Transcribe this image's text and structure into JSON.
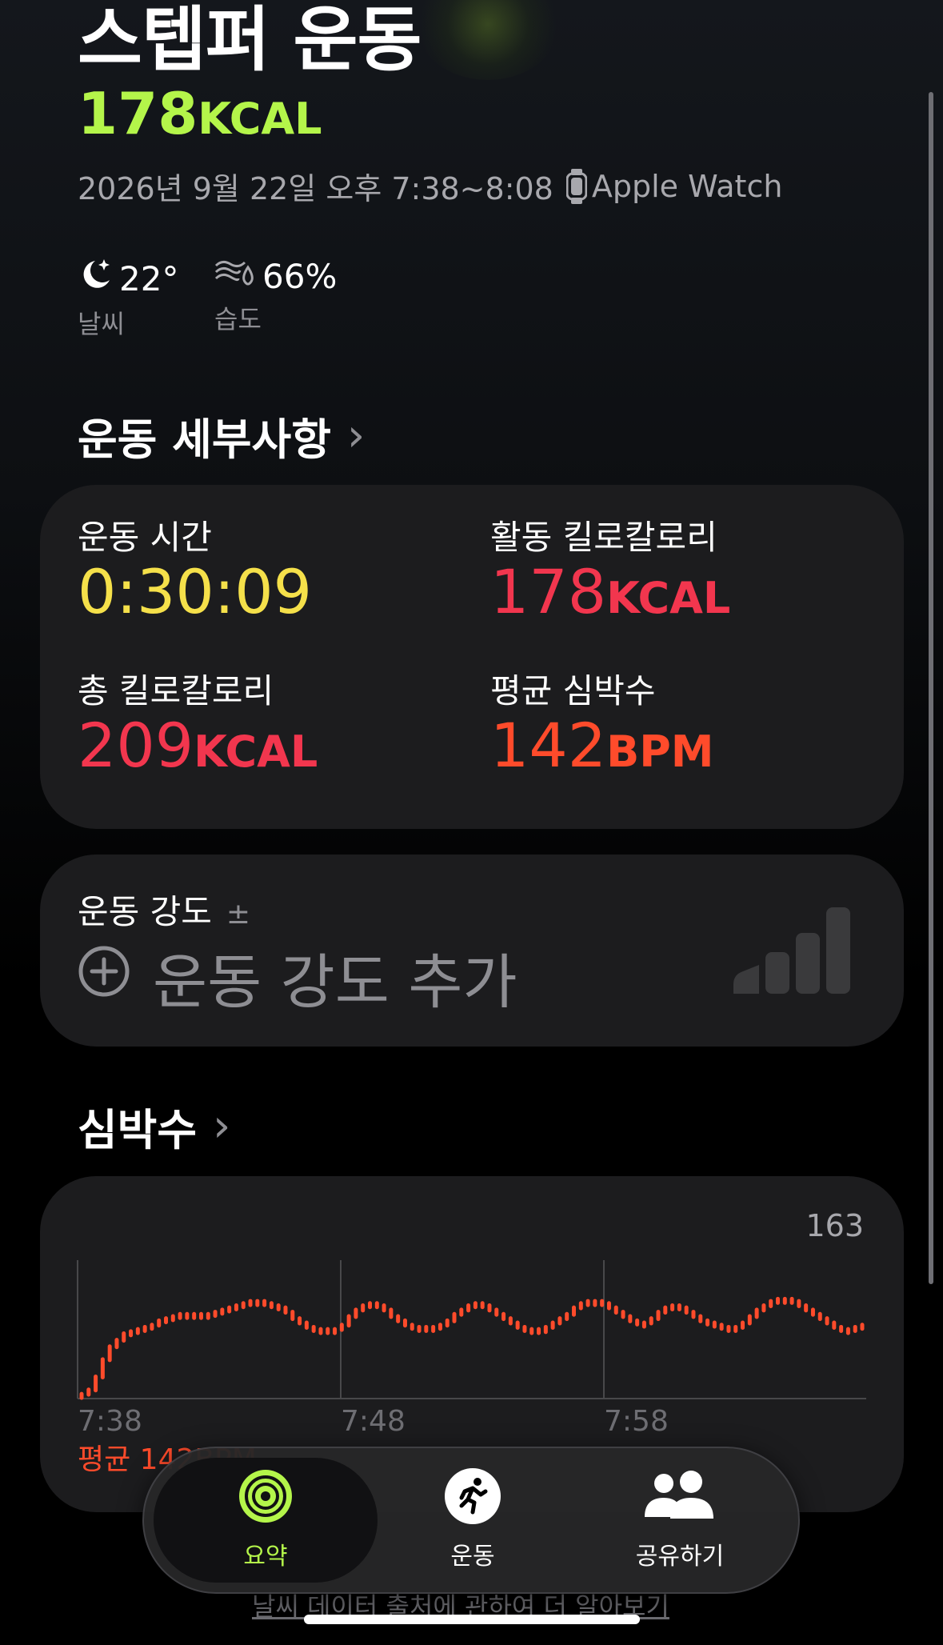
{
  "header": {
    "title": "스텝퍼 운동",
    "kcal_value": "178",
    "kcal_unit": "KCAL",
    "datetime": "2026년 9월 22일 오후 7:38~8:08",
    "device": "Apple Watch",
    "device_icon": "watch-icon"
  },
  "weather": {
    "temp": {
      "icon": "moon-stars-icon",
      "value": "22°",
      "label": "날씨"
    },
    "humidity": {
      "icon": "humidity-icon",
      "value": "66%",
      "label": "습도"
    }
  },
  "details": {
    "title": "운동 세부사항",
    "chevron": "›",
    "metrics": [
      {
        "label": "운동 시간",
        "value": "0:30:09",
        "unit": "",
        "color": "#f5e04a"
      },
      {
        "label": "활동 킬로칼로리",
        "value": "178",
        "unit": "KCAL",
        "color": "#f2364e"
      },
      {
        "label": "총 킬로칼로리",
        "value": "209",
        "unit": "KCAL",
        "color": "#f2364e"
      },
      {
        "label": "평균 심박수",
        "value": "142",
        "unit": "BPM",
        "color": "#ff4b2b"
      }
    ]
  },
  "effort": {
    "label": "운동 강도",
    "plus_minus": "±",
    "add_label": "운동 강도 추가",
    "add_icon": "plus-circle-icon",
    "meter_icon": "effort-meter-icon"
  },
  "heart_rate": {
    "title": "심박수",
    "chevron": "›",
    "max_label": "163",
    "x_ticks": [
      "7:38",
      "7:48",
      "7:58"
    ],
    "avg_label": "평균 142BPM",
    "color": "#ff4b2b"
  },
  "chart_data": {
    "type": "line",
    "title": "",
    "xlabel": "",
    "ylabel": "",
    "x_ticks": [
      "7:38",
      "7:48",
      "7:58"
    ],
    "ylim": [
      100,
      163
    ],
    "series": [
      {
        "values": [
          102,
          104,
          110,
          118,
          124,
          127,
          130,
          131,
          132,
          133,
          134,
          136,
          137,
          138,
          139,
          139,
          138,
          139,
          139,
          140,
          141,
          142,
          143,
          144,
          145,
          145,
          144,
          143,
          142,
          140,
          137,
          135,
          133,
          132,
          131,
          132,
          132,
          134,
          138,
          141,
          143,
          144,
          143,
          141,
          138,
          136,
          134,
          133,
          133,
          132,
          133,
          134,
          136,
          139,
          141,
          143,
          144,
          143,
          141,
          139,
          137,
          135,
          133,
          132,
          132,
          131,
          133,
          135,
          137,
          139,
          142,
          144,
          145,
          145,
          144,
          142,
          140,
          138,
          136,
          135,
          135,
          137,
          140,
          142,
          143,
          142,
          140,
          138,
          136,
          135,
          134,
          133,
          132,
          133,
          135,
          138,
          141,
          143,
          145,
          146,
          146,
          145,
          143,
          141,
          139,
          137,
          135,
          133,
          132,
          132,
          133,
          134
        ]
      }
    ]
  },
  "tabbar": {
    "tabs": [
      {
        "label": "요약",
        "icon": "activity-rings-icon",
        "active": true
      },
      {
        "label": "운동",
        "icon": "running-icon",
        "active": false
      },
      {
        "label": "공유하기",
        "icon": "people-icon",
        "active": false
      }
    ]
  },
  "footer": {
    "link_text": "날씨 데이터 출처에 관하여 더 알아보기"
  },
  "colors": {
    "accent_green": "#b4f54a",
    "yellow": "#f5e04a",
    "pink": "#f2364e",
    "red": "#ff4b2b"
  }
}
